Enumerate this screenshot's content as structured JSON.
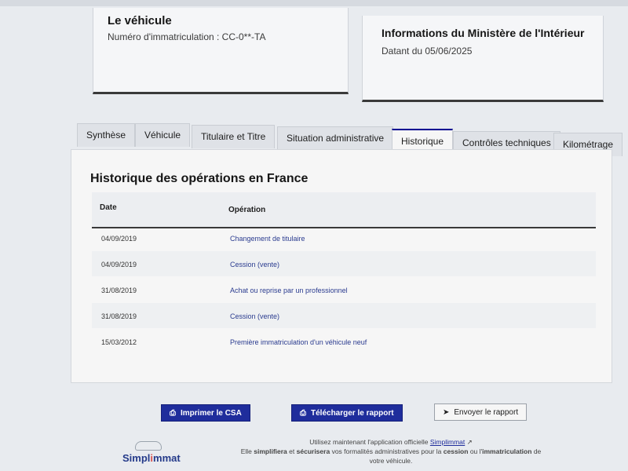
{
  "vehicle_card": {
    "title": "Le véhicule",
    "registration": "Numéro d'immatriculation : CC-0**-TA"
  },
  "ministry_card": {
    "title": "Informations du Ministère de l'Intérieur",
    "date": "Datant du 05/06/2025"
  },
  "tabs": [
    {
      "label": "Synthèse"
    },
    {
      "label": "Véhicule"
    },
    {
      "label": "Titulaire et Titre"
    },
    {
      "label": "Situation administrative"
    },
    {
      "label": "Historique"
    },
    {
      "label": "Contrôles techniques"
    },
    {
      "label": "Kilométrage"
    }
  ],
  "history": {
    "title": "Historique des opérations en France",
    "columns": {
      "date": "Date",
      "operation": "Opération"
    },
    "rows": [
      {
        "date": "04/09/2019",
        "operation": "Changement de titulaire"
      },
      {
        "date": "04/09/2019",
        "operation": "Cession (vente)"
      },
      {
        "date": "31/08/2019",
        "operation": "Achat ou reprise par un professionnel"
      },
      {
        "date": "31/08/2019",
        "operation": "Cession (vente)"
      },
      {
        "date": "15/03/2012",
        "operation": "Première immatriculation d'un véhicule neuf"
      }
    ]
  },
  "actions": {
    "print": "Imprimer le CSA",
    "download": "Télécharger le rapport",
    "send": "Envoyer le rapport"
  },
  "footer": {
    "logo_main": "Simpl",
    "logo_accent": "i",
    "logo_end": "mmat",
    "line1_prefix": "Utilisez maintenant l'application officielle",
    "link": "Simplimmat",
    "line2_a": "Elle",
    "line2_b": "simplifiera",
    "line2_c": "et",
    "line2_d": "sécurisera",
    "line2_e": "vos formalités administratives pour la",
    "line2_f": "cession",
    "line2_g": "ou l'",
    "line2_h": "immatriculation",
    "line2_i": "de",
    "line3": "votre véhicule."
  },
  "colors": {
    "primary": "#1f2d9c",
    "tab_active_accent": "#000091"
  }
}
